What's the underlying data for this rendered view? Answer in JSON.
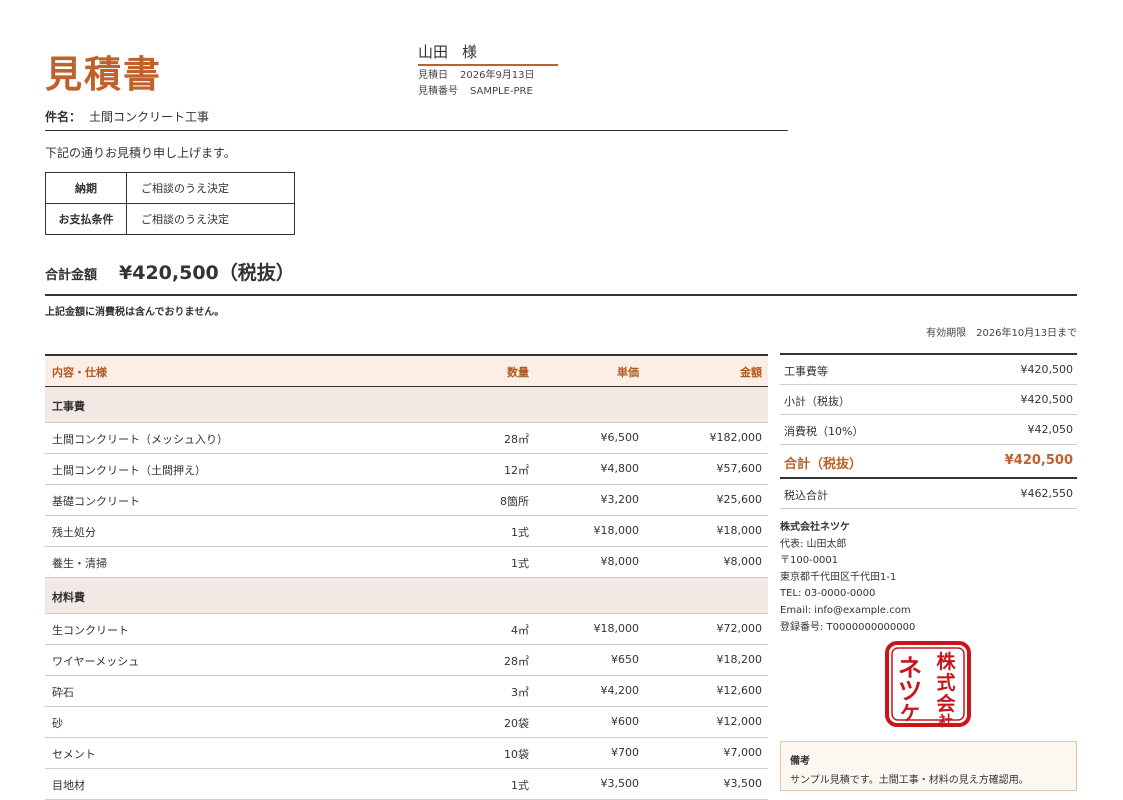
{
  "document": {
    "title": "見積書",
    "client_name": "山田",
    "client_honorific": "様",
    "date_label": "見積日",
    "date": "2026年9月13日",
    "number_label": "見積番号",
    "number": "SAMPLE-PRE",
    "subject_label": "件名：",
    "subject": "土間コンクリート工事",
    "intro": "下記の通りお見積り申し上げます。"
  },
  "terms": [
    {
      "label": "納期",
      "value": "ご相談のうえ決定"
    },
    {
      "label": "お支払条件",
      "value": "ご相談のうえ決定"
    }
  ],
  "total": {
    "label": "合計金額",
    "amount": "¥420,500（税抜）",
    "note": "上記金額に消費税は含んでおりません。",
    "validity_label": "有効期限",
    "validity_date": "2026年10月13日まで"
  },
  "table": {
    "headers": {
      "item": "内容・仕様",
      "qty": "数量",
      "price": "単価",
      "amount": "金額"
    },
    "sections": [
      {
        "title": "工事費",
        "rows": [
          {
            "name": "土間コンクリート（メッシュ入り）",
            "qty": "28㎡",
            "price": "¥6,500",
            "amount": "¥182,000"
          },
          {
            "name": "土間コンクリート（土間押え）",
            "qty": "12㎡",
            "price": "¥4,800",
            "amount": "¥57,600"
          },
          {
            "name": "基礎コンクリート",
            "qty": "8箇所",
            "price": "¥3,200",
            "amount": "¥25,600"
          },
          {
            "name": "残土処分",
            "qty": "1式",
            "price": "¥18,000",
            "amount": "¥18,000"
          },
          {
            "name": "養生・清掃",
            "qty": "1式",
            "price": "¥8,000",
            "amount": "¥8,000"
          }
        ]
      },
      {
        "title": "材料費",
        "rows": [
          {
            "name": "生コンクリート",
            "qty": "4㎥",
            "price": "¥18,000",
            "amount": "¥72,000"
          },
          {
            "name": "ワイヤーメッシュ",
            "qty": "28㎡",
            "price": "¥650",
            "amount": "¥18,200"
          },
          {
            "name": "砕石",
            "qty": "3㎥",
            "price": "¥4,200",
            "amount": "¥12,600"
          },
          {
            "name": "砂",
            "qty": "20袋",
            "price": "¥600",
            "amount": "¥12,000"
          },
          {
            "name": "セメント",
            "qty": "10袋",
            "price": "¥700",
            "amount": "¥7,000"
          },
          {
            "name": "目地材",
            "qty": "1式",
            "price": "¥3,500",
            "amount": "¥3,500"
          }
        ]
      }
    ]
  },
  "summary": {
    "construction_label": "工事費等",
    "construction": "¥420,500",
    "subtotal_label": "小計（税抜）",
    "subtotal": "¥420,500",
    "tax_label": "消費税（10%）",
    "tax": "¥42,050",
    "grand_label": "合計（税抜）",
    "grand": "¥420,500",
    "incl_label": "税込合計",
    "incl": "¥462,550"
  },
  "company": {
    "name": "株式会社ネツケ",
    "rep": "代表: 山田太郎",
    "postal": "〒100-0001",
    "address": "東京都千代田区千代田1-1",
    "tel": "TEL: 03-0000-0000",
    "email": "Email: info@example.com",
    "reg": "登録番号: T0000000000000",
    "seal_text": "株式会社ネツケ"
  },
  "remarks": {
    "title": "備考",
    "text": "サンプル見積です。土間工事・材料の見え方確認用。"
  },
  "colors": {
    "accent": "#c0602a",
    "seal": "#c8161d",
    "header_bg": "#fbeee5",
    "section_bg": "#f2e9e5"
  }
}
